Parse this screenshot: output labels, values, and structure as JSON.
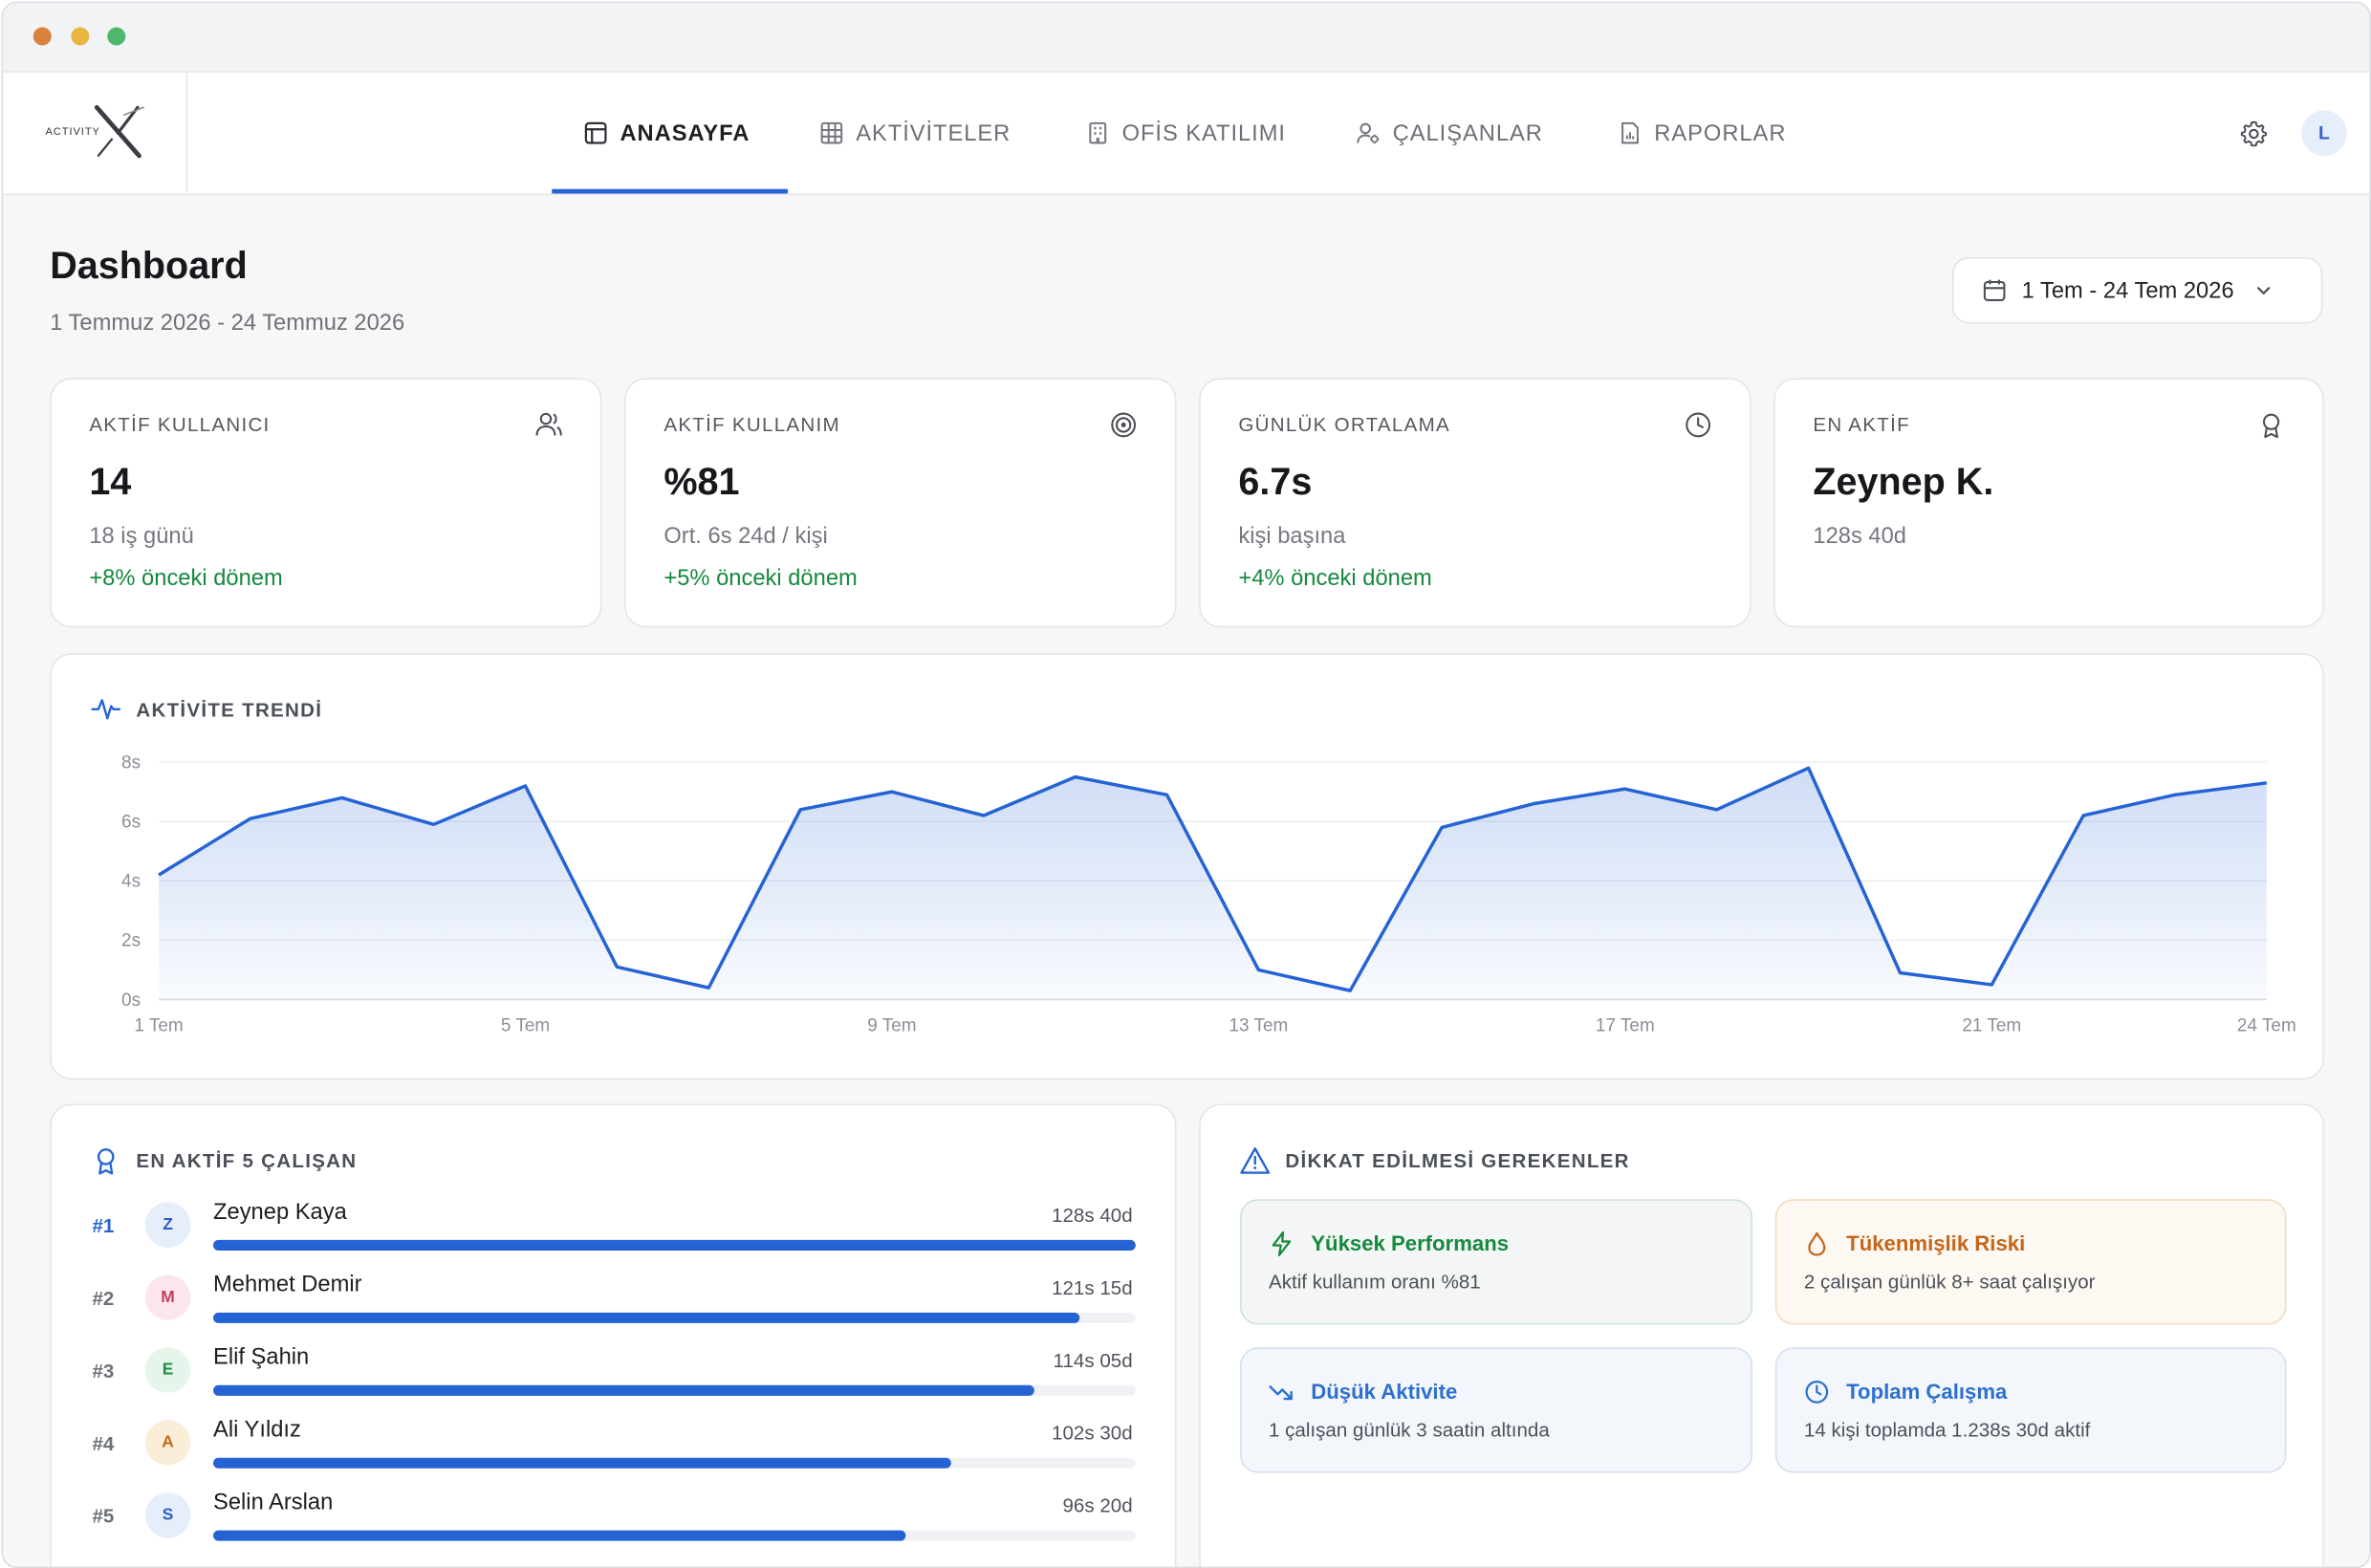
{
  "window": {
    "traffic_lights": [
      "#d9823b",
      "#e9b540",
      "#4fb76b"
    ]
  },
  "brand": {
    "small": "ACTIVITY",
    "mark": "X"
  },
  "nav": {
    "tabs": [
      {
        "label": "ANASAYFA",
        "icon": "layout-icon",
        "active": true
      },
      {
        "label": "AKTİVİTELER",
        "icon": "table-icon",
        "active": false
      },
      {
        "label": "OFİS KATILIMI",
        "icon": "building-icon",
        "active": false
      },
      {
        "label": "ÇALIŞANLAR",
        "icon": "users-cog-icon",
        "active": false
      },
      {
        "label": "RAPORLAR",
        "icon": "report-icon",
        "active": false
      }
    ],
    "avatar": "L"
  },
  "header": {
    "title": "Dashboard",
    "subtitle": "1 Temmuz 2026 - 24 Temmuz 2026",
    "date_range": "1 Tem - 24 Tem 2026"
  },
  "stats": [
    {
      "title": "AKTİF KULLANICI",
      "value": "14",
      "sub": "18 iş günü",
      "delta": "+8% önceki dönem",
      "icon": "users-icon"
    },
    {
      "title": "AKTİF KULLANIM",
      "value": "%81",
      "sub": "Ort. 6s 24d / kişi",
      "delta": "+5% önceki dönem",
      "icon": "target-icon"
    },
    {
      "title": "GÜNLÜK ORTALAMA",
      "value": "6.7s",
      "sub": "kişi başına",
      "delta": "+4% önceki dönem",
      "icon": "clock-icon"
    },
    {
      "title": "EN AKTİF",
      "value": "Zeynep K.",
      "sub": "128s 40d",
      "delta": "",
      "icon": "award-icon"
    }
  ],
  "trend": {
    "title": "AKTİVİTE TRENDİ",
    "accent": "#2563d4"
  },
  "chart_data": {
    "type": "area",
    "title": "AKTİVİTE TRENDİ",
    "x": [
      1,
      2,
      3,
      4,
      5,
      6,
      7,
      8,
      9,
      10,
      11,
      12,
      13,
      14,
      15,
      16,
      17,
      18,
      19,
      20,
      21,
      22,
      23,
      24
    ],
    "x_tick_labels": [
      "1 Tem",
      "5 Tem",
      "9 Tem",
      "13 Tem",
      "17 Tem",
      "21 Tem",
      "24 Tem"
    ],
    "x_tick_positions": [
      1,
      5,
      9,
      13,
      17,
      21,
      24
    ],
    "y_tick_labels": [
      "0s",
      "2s",
      "4s",
      "6s",
      "8s"
    ],
    "y_tick_values": [
      0,
      2,
      4,
      6,
      8
    ],
    "series": [
      {
        "values": [
          4.2,
          6.1,
          6.8,
          5.9,
          7.2,
          1.1,
          0.4,
          6.4,
          7.0,
          6.2,
          7.5,
          6.9,
          1.0,
          0.3,
          5.8,
          6.6,
          7.1,
          6.4,
          7.8,
          0.9,
          0.5,
          6.2,
          6.9,
          7.3
        ]
      }
    ],
    "ylim": [
      0,
      8
    ],
    "grid": true,
    "xlabel": "",
    "ylabel": ""
  },
  "top_employees": {
    "title": "EN AKTİF 5 ÇALIŞAN",
    "items": [
      {
        "rank": "#1",
        "initial": "Z",
        "name": "Zeynep Kaya",
        "value": "128s 40d",
        "fraction": 1.0,
        "av_bg": "#e6edfb",
        "av_fg": "#2d5fc4"
      },
      {
        "rank": "#2",
        "initial": "M",
        "name": "Mehmet Demir",
        "value": "121s 15d",
        "fraction": 0.94,
        "av_bg": "#fbe6ee",
        "av_fg": "#c4405f"
      },
      {
        "rank": "#3",
        "initial": "E",
        "name": "Elif Şahin",
        "value": "114s 05d",
        "fraction": 0.89,
        "av_bg": "#e6f5ea",
        "av_fg": "#1f8a45"
      },
      {
        "rank": "#4",
        "initial": "A",
        "name": "Ali Yıldız",
        "value": "102s 30d",
        "fraction": 0.8,
        "av_bg": "#fbeed9",
        "av_fg": "#c26a12"
      },
      {
        "rank": "#5",
        "initial": "S",
        "name": "Selin Arslan",
        "value": "96s 20d",
        "fraction": 0.75,
        "av_bg": "#e6edfb",
        "av_fg": "#2d5fc4"
      }
    ]
  },
  "alerts": {
    "title": "DİKKAT EDİLMESİ GEREKENLER",
    "items": [
      {
        "title": "Yüksek Performans",
        "text": "Aktif kullanım oranı %81",
        "icon": "bolt-icon",
        "color": "#15893d",
        "bg": "#f3f6f5",
        "border": "#cfe3d6"
      },
      {
        "title": "Tükenmişlik Riski",
        "text": "2 çalışan günlük 8+ saat çalışıyor",
        "icon": "flame-icon",
        "color": "#c4661a",
        "bg": "#fdf8f1",
        "border": "#f1dcc0"
      },
      {
        "title": "Düşük Aktivite",
        "text": "1 çalışan günlük 3 saatin altında",
        "icon": "trend-down-icon",
        "color": "#2d6fd0",
        "bg": "#f3f7fc",
        "border": "#d3e0f0"
      },
      {
        "title": "Toplam Çalışma",
        "text": "14 kişi toplamda 1.238s 30d aktif",
        "icon": "clock-icon",
        "color": "#2d6fd0",
        "bg": "#f3f7fc",
        "border": "#d3e0f0"
      }
    ]
  }
}
